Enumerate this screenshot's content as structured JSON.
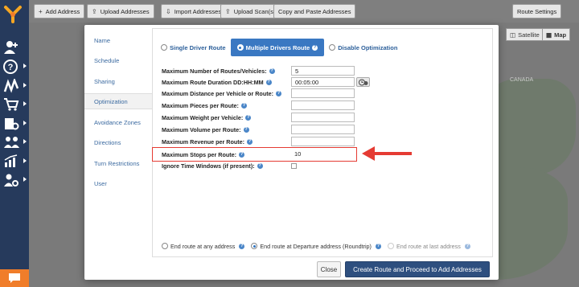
{
  "toolbar": {
    "buttons": [
      {
        "label": "Add Address",
        "icon": "plus-icon"
      },
      {
        "label": "Upload Addresses",
        "icon": "upload-icon"
      },
      {
        "label": "Import Addresses",
        "icon": "import-icon"
      },
      {
        "label": "Upload Scan(s)",
        "icon": "upload-icon"
      },
      {
        "label": "Copy and Paste Addresses",
        "icon": ""
      }
    ],
    "route_settings": "Route Settings"
  },
  "map": {
    "satellite": "Satellite",
    "map": "Map",
    "water_label": "CANADA"
  },
  "modal": {
    "tabs": [
      {
        "label": "Name"
      },
      {
        "label": "Schedule"
      },
      {
        "label": "Sharing"
      },
      {
        "label": "Optimization",
        "active": true
      },
      {
        "label": "Avoidance Zones"
      },
      {
        "label": "Directions"
      },
      {
        "label": "Turn Restrictions"
      },
      {
        "label": "User"
      }
    ],
    "optimization_modes": {
      "single": "Single Driver Route",
      "multiple": "Multiple Drivers Route",
      "disable": "Disable Optimization",
      "selected": "multiple"
    },
    "fields": [
      {
        "label": "Maximum Number of Routes/Vehicles:",
        "value": "5"
      },
      {
        "label": "Maximum Route Duration DD:HH:MM",
        "value": "00:05:00"
      },
      {
        "label": "Maximum Distance per Vehicle or Route:",
        "value": ""
      },
      {
        "label": "Maximum Pieces per Route:",
        "value": ""
      },
      {
        "label": "Maximum Weight per Vehicle:",
        "value": ""
      },
      {
        "label": "Maximum Volume per Route:",
        "value": ""
      },
      {
        "label": "Maximum Revenue per Route:",
        "value": ""
      },
      {
        "label": "Maximum Stops per Route:",
        "value": "10"
      },
      {
        "label": "Ignore Time Windows (if present):",
        "checked": false
      }
    ],
    "end_route": {
      "any": "End route at any address",
      "departure": "End route at Departure address (Roundtrip)",
      "last": "End route at last address",
      "selected": "departure"
    },
    "buttons": {
      "close": "Close",
      "create": "Create Route and Proceed to Add Addresses"
    }
  },
  "colors": {
    "sidebar": "#263a5c",
    "accent": "#3a78c2",
    "primary_button": "#2e4f7f",
    "highlight": "#e53b33",
    "chat": "#f07d2a"
  }
}
